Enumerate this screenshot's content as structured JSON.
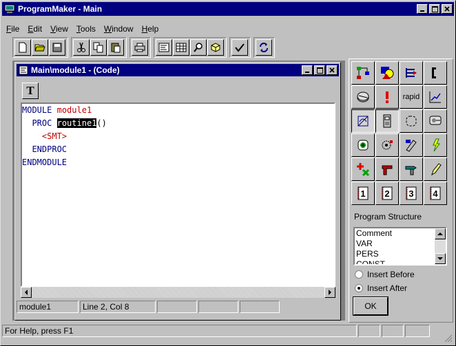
{
  "app": {
    "title": "ProgramMaker - Main"
  },
  "menu": [
    "File",
    "Edit",
    "View",
    "Tools",
    "Window",
    "Help"
  ],
  "toolbar": {
    "buttons": [
      "new-file-icon",
      "open-folder-icon",
      "save-icon",
      "cut-icon",
      "copy-icon",
      "paste-icon",
      "print-icon",
      "code-view-icon",
      "data-table-icon",
      "find-icon",
      "module-icon",
      "check-icon",
      "sync-icon"
    ]
  },
  "child": {
    "title": "Main\\module1 - (Code)",
    "text_button": "T",
    "code": {
      "l1_kw": "MODULE",
      "l1_name": "module1",
      "l2_kw": "PROC",
      "l2_name": "routine1",
      "l2_tail": "()",
      "l3": "<SMT>",
      "l4": "ENDPROC",
      "l5": "ENDMODULE"
    },
    "status": {
      "module": "module1",
      "position": "Line   2, Col   8"
    }
  },
  "palette": {
    "buttons": [
      "flowchart-icon",
      "shapes-icon",
      "move-icon",
      "phone-icon",
      "disk-icon",
      "alert-icon",
      "rapid-text",
      "chart-icon",
      "no-signal-icon",
      "io-panel-icon",
      "loop-icon",
      "robot-arm-icon",
      "target-icon",
      "gear-hand-icon",
      "pen-tool-icon",
      "spark-icon",
      "add-delete-icon",
      "pipe-icon",
      "drill-icon",
      "pencil-icon",
      "slot-1",
      "slot-2",
      "slot-3",
      "slot-4"
    ],
    "rapid_label": "rapid",
    "slots": [
      "1",
      "2",
      "3",
      "4"
    ]
  },
  "program_structure": {
    "label": "Program Structure",
    "items": [
      "Comment",
      "VAR",
      "PERS",
      "CONST"
    ],
    "insert_before": "Insert Before",
    "insert_after": "Insert After",
    "selected": "Insert After",
    "ok": "OK"
  },
  "statusbar": {
    "help": "For Help, press F1"
  }
}
